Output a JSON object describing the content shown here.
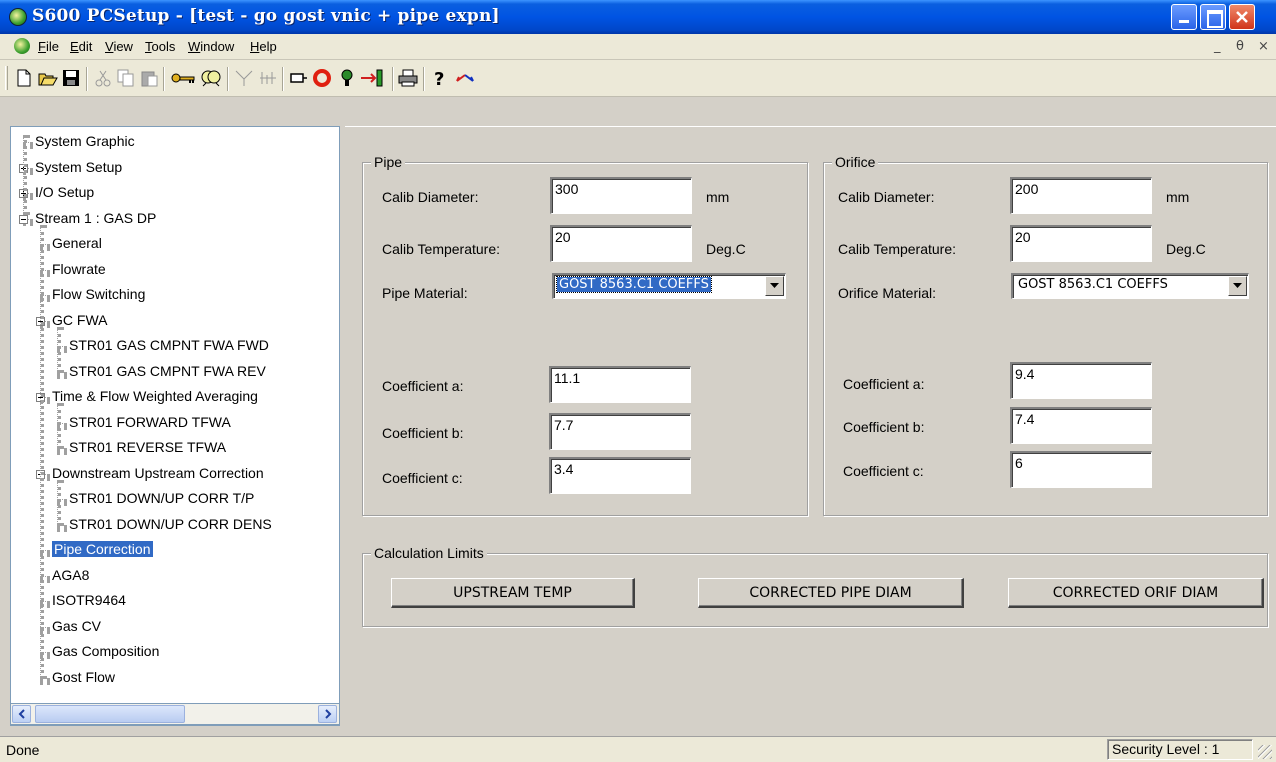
{
  "window": {
    "title": "S600 PCSetup - [test - go gost vnic + pipe expn]",
    "minimize_icon": "minimize-icon",
    "maximize_icon": "maximize-icon",
    "close_icon": "close-icon"
  },
  "menu": {
    "items": [
      "File",
      "Edit",
      "View",
      "Tools",
      "Window",
      "Help"
    ],
    "mdi_controls": [
      "_",
      "θ",
      "×"
    ]
  },
  "toolbar": {
    "tools": [
      "new-icon",
      "open-icon",
      "save-icon",
      "cut-icon",
      "copy-icon",
      "paste-icon",
      "key-icon",
      "find-icon",
      "connect-icon",
      "compare-icon",
      "port-icon",
      "ring-icon",
      "bulb-icon",
      "transfer-icon",
      "print-icon",
      "help-icon",
      "exchange-icon"
    ]
  },
  "tree": {
    "items": [
      {
        "label": "System Graphic",
        "level": 0,
        "expander": "none"
      },
      {
        "label": "System Setup",
        "level": 0,
        "expander": "plus"
      },
      {
        "label": "I/O Setup",
        "level": 0,
        "expander": "plus"
      },
      {
        "label": "Stream 1 : GAS DP",
        "level": 0,
        "expander": "minus"
      },
      {
        "label": "General",
        "level": 1,
        "expander": "none"
      },
      {
        "label": "Flowrate",
        "level": 1,
        "expander": "none"
      },
      {
        "label": "Flow Switching",
        "level": 1,
        "expander": "none"
      },
      {
        "label": "GC FWA",
        "level": 1,
        "expander": "minus"
      },
      {
        "label": "STR01 GAS CMPNT FWA FWD",
        "level": 2,
        "expander": "none"
      },
      {
        "label": "STR01 GAS CMPNT FWA REV",
        "level": 2,
        "expander": "none"
      },
      {
        "label": "Time & Flow Weighted Averaging",
        "level": 1,
        "expander": "minus"
      },
      {
        "label": "STR01 FORWARD TFWA",
        "level": 2,
        "expander": "none"
      },
      {
        "label": "STR01 REVERSE TFWA",
        "level": 2,
        "expander": "none"
      },
      {
        "label": "Downstream Upstream Correction",
        "level": 1,
        "expander": "minus"
      },
      {
        "label": "STR01 DOWN/UP CORR T/P",
        "level": 2,
        "expander": "none"
      },
      {
        "label": "STR01 DOWN/UP CORR DENS",
        "level": 2,
        "expander": "none"
      },
      {
        "label": "Pipe Correction",
        "level": 1,
        "expander": "none",
        "selected": true
      },
      {
        "label": "AGA8",
        "level": 1,
        "expander": "none"
      },
      {
        "label": "ISOTR9464",
        "level": 1,
        "expander": "none"
      },
      {
        "label": "Gas CV",
        "level": 1,
        "expander": "none"
      },
      {
        "label": "Gas Composition",
        "level": 1,
        "expander": "none"
      },
      {
        "label": "Gost Flow",
        "level": 1,
        "expander": "none"
      }
    ]
  },
  "pipe": {
    "legend": "Pipe",
    "calib_diameter_label": "Calib Diameter:",
    "calib_diameter_value": "300",
    "calib_diameter_unit": "mm",
    "calib_temperature_label": "Calib Temperature:",
    "calib_temperature_value": "20",
    "calib_temperature_unit": "Deg.C",
    "material_label": "Pipe Material:",
    "material_value": "GOST 8563.C1 COEFFS",
    "coef_a_label": "Coefficient a:",
    "coef_a_value": "11.1",
    "coef_b_label": "Coefficient b:",
    "coef_b_value": "7.7",
    "coef_c_label": "Coefficient c:",
    "coef_c_value": "3.4"
  },
  "orifice": {
    "legend": "Orifice",
    "calib_diameter_label": "Calib Diameter:",
    "calib_diameter_value": "200",
    "calib_diameter_unit": "mm",
    "calib_temperature_label": "Calib Temperature:",
    "calib_temperature_value": "20",
    "calib_temperature_unit": "Deg.C",
    "material_label": "Orifice Material:",
    "material_value": "GOST 8563.C1 COEFFS",
    "coef_a_label": "Coefficient a:",
    "coef_a_value": "9.4",
    "coef_b_label": "Coefficient b:",
    "coef_b_value": "7.4",
    "coef_c_label": "Coefficient c:",
    "coef_c_value": "6"
  },
  "limits": {
    "legend": "Calculation Limits",
    "upstream_temp": "UPSTREAM TEMP",
    "corrected_pipe_diam": "CORRECTED PIPE DIAM",
    "corrected_orif_diam": "CORRECTED ORIF DIAM"
  },
  "status": {
    "text": "Done",
    "security": "Security Level : 1"
  },
  "colors": {
    "titlebar": "#0054e3",
    "selection": "#316ac5",
    "dialog": "#d4d0c8"
  }
}
